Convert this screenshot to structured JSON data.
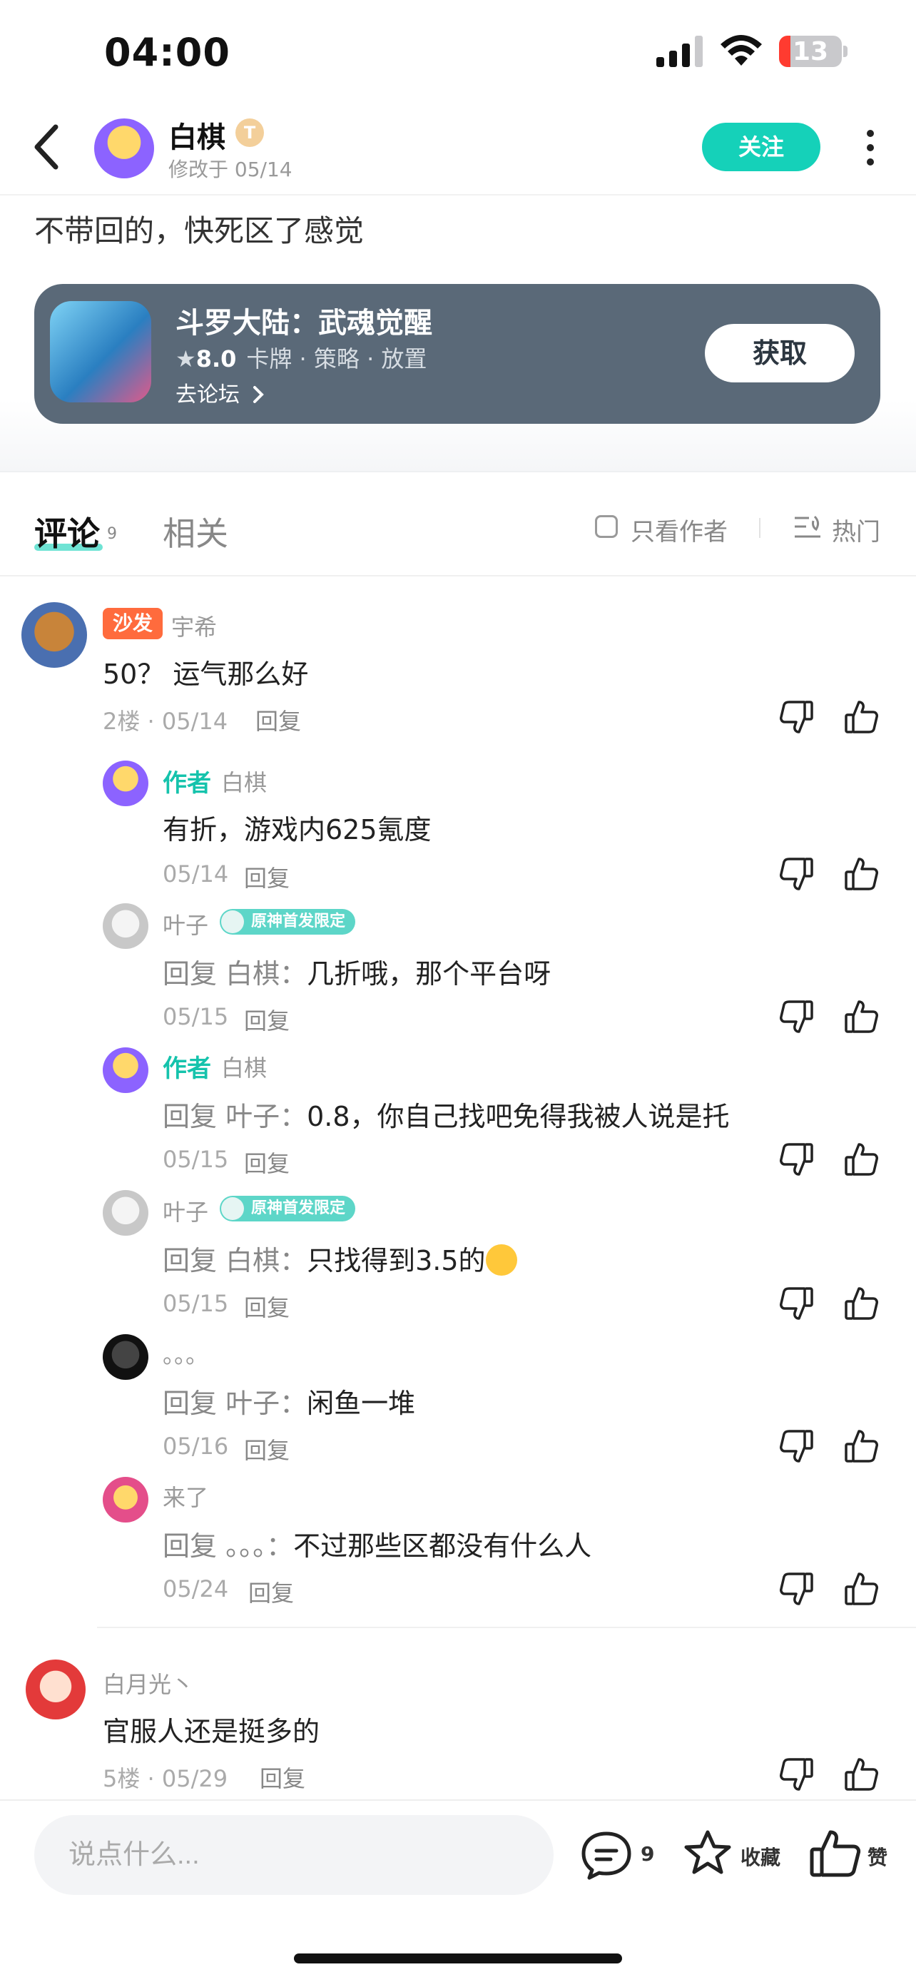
{
  "status_bar": {
    "time": "04:00",
    "battery": "13"
  },
  "header": {
    "author_name": "白棋",
    "author_badge": "T",
    "modified": "修改于 05/14",
    "follow_label": "关注"
  },
  "post": {
    "text": "不带回的，快死区了感觉"
  },
  "game_card": {
    "title": "斗罗大陆：武魂觉醒",
    "rating": "8.0",
    "tags": "卡牌 · 策略 · 放置",
    "forum_link": "去论坛",
    "get_label": "获取"
  },
  "tabs": {
    "comments_label": "评论",
    "comments_count": "9",
    "related_label": "相关",
    "author_only_label": "只看作者",
    "sort_label": "热门"
  },
  "comments": [
    {
      "tag": "沙发",
      "name": "宇希",
      "text": "50？ 运气那么好",
      "meta": "2楼 · 05/14",
      "reply_label": "回复",
      "replies": [
        {
          "author_tag": "作者",
          "name": "白棋",
          "prefix": "",
          "text": "有折，游戏内625氪度",
          "meta": "05/14",
          "reply_label": "回复"
        },
        {
          "name": "叶子",
          "medal": "原神首发限定",
          "prefix": "回复 白棋：",
          "text": "几折哦，那个平台呀",
          "meta": "05/15",
          "reply_label": "回复"
        },
        {
          "author_tag": "作者",
          "name": "白棋",
          "prefix": "回复 叶子：",
          "text": "0.8，你自己找吧免得我被人说是托",
          "meta": "05/15",
          "reply_label": "回复"
        },
        {
          "name": "叶子",
          "medal": "原神首发限定",
          "prefix": "回复 白棋：",
          "text": "只找得到3.5的",
          "meta": "05/15",
          "reply_label": "回复"
        },
        {
          "name": "。。。",
          "prefix": "回复 叶子：",
          "text": "闲鱼一堆",
          "meta": "05/16",
          "reply_label": "回复"
        },
        {
          "name": "来了",
          "prefix": "回复 。。。：",
          "text": "不过那些区都没有什么人",
          "meta": "05/24",
          "reply_label": "回复"
        }
      ]
    },
    {
      "name": "白月光丶",
      "text": "官服人还是挺多的",
      "meta": "5楼 · 05/29",
      "reply_label": "回复"
    }
  ],
  "bottom_bar": {
    "input_placeholder": "说点什么...",
    "comment_count": "9",
    "favorite_label": "收藏",
    "like_label": "赞"
  },
  "colors": {
    "accent": "#15d1b9",
    "sofa_tag": "#ff6b3d",
    "card_bg": "#5a6978"
  },
  "icons": [
    "back-icon",
    "signal-icon",
    "wifi-icon",
    "more-icon",
    "star-icon",
    "chevron-right-icon",
    "sort-icon",
    "dislike-icon",
    "like-icon",
    "comment-icon",
    "favorite-icon"
  ]
}
